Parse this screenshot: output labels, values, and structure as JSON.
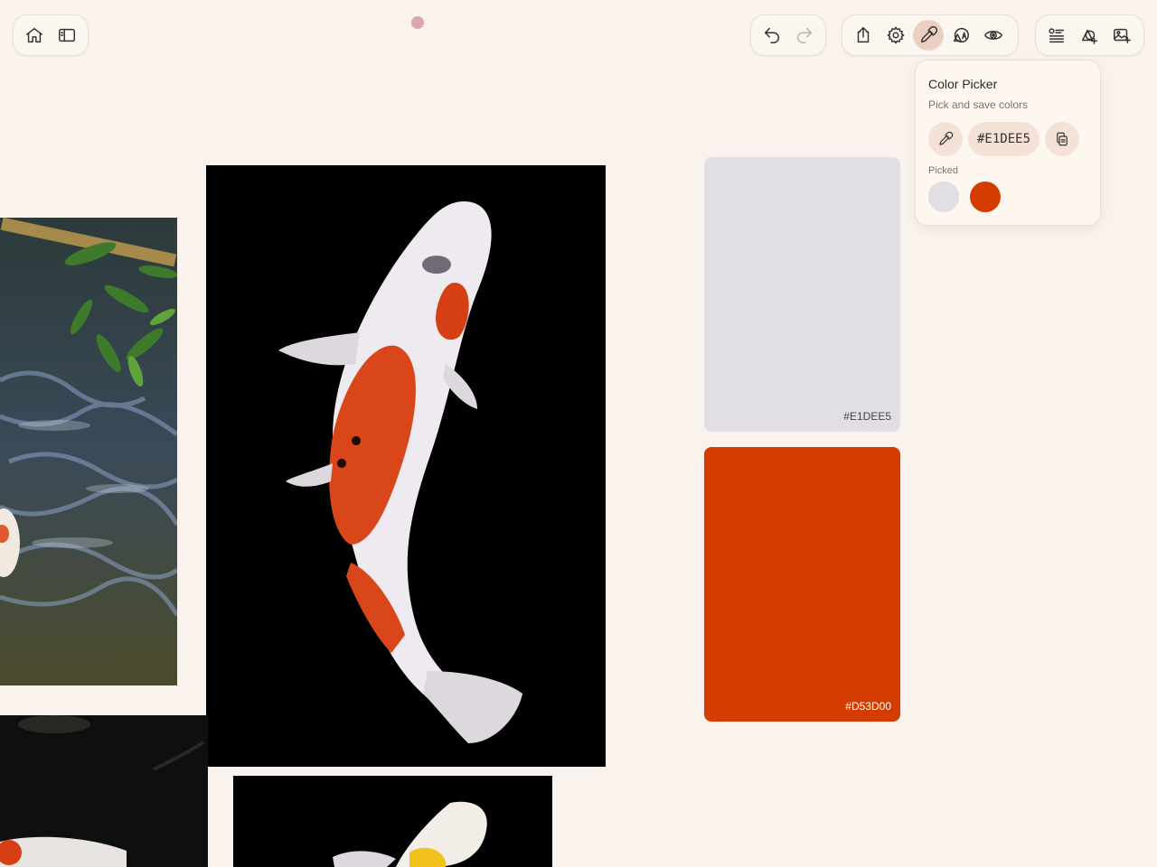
{
  "toolbar": {
    "left": [
      {
        "icon": "home-icon"
      },
      {
        "icon": "sidebar-icon"
      }
    ],
    "history": [
      {
        "icon": "undo-icon"
      },
      {
        "icon": "redo-icon"
      }
    ],
    "tools": [
      {
        "icon": "share-icon"
      },
      {
        "icon": "gear-icon"
      },
      {
        "icon": "eyedropper-icon",
        "active": true
      },
      {
        "icon": "shapes-icon"
      },
      {
        "icon": "eye-icon"
      }
    ],
    "right": [
      {
        "icon": "list-add-icon"
      },
      {
        "icon": "shape-add-icon"
      },
      {
        "icon": "image-add-icon"
      }
    ]
  },
  "color_picker": {
    "title": "Color Picker",
    "subtitle": "Pick and save colors",
    "current_hex": "#E1DEE5",
    "picked_label": "Picked",
    "picked": [
      "#E1DEE5",
      "#D53D00"
    ]
  },
  "color_cards": [
    {
      "hex": "#E1DEE5",
      "label": "#E1DEE5",
      "label_color": "#444444"
    },
    {
      "hex": "#D53D00",
      "label": "#D53D00",
      "label_color": "#ffffff"
    }
  ],
  "colors": {
    "background": "#FAF2EC",
    "accent_dot": "#D7A7B2",
    "active_tool": "#EBCFC0"
  }
}
